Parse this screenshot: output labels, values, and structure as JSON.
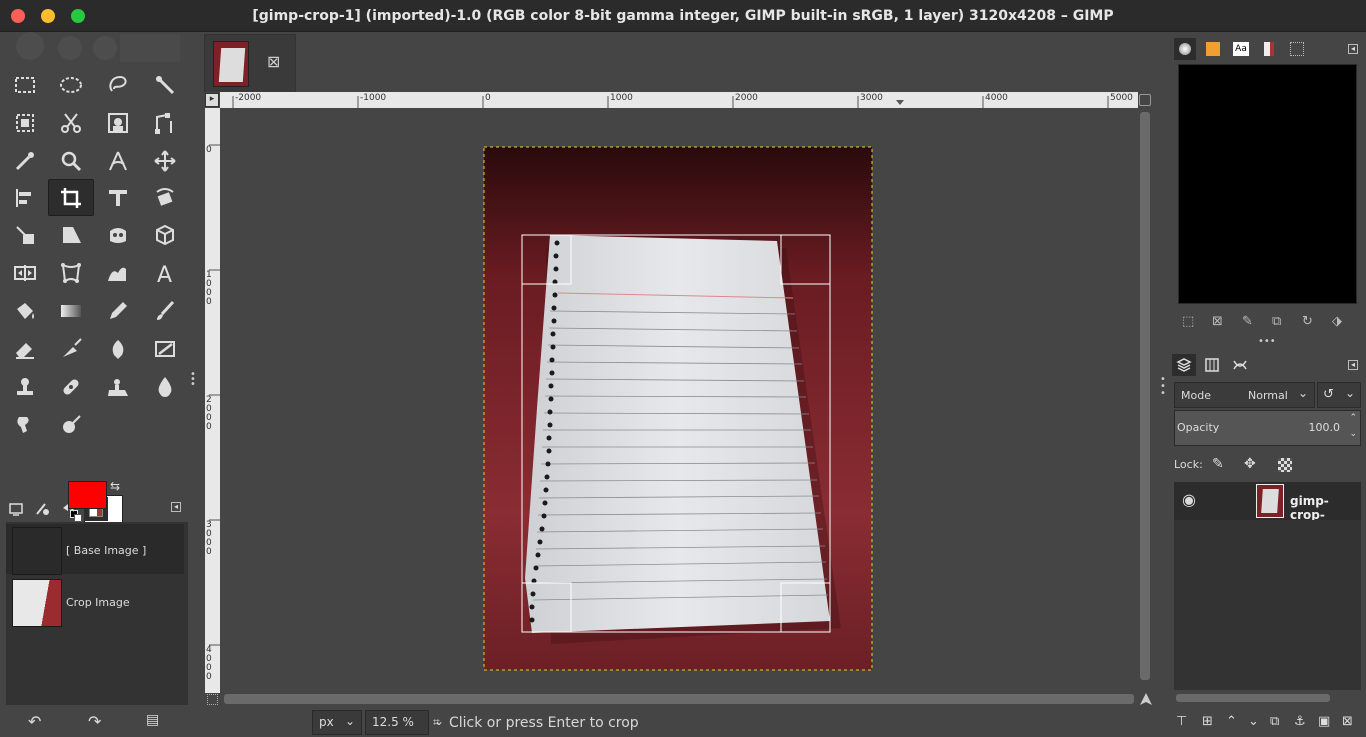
{
  "window": {
    "title": "[gimp-crop-1] (imported)-1.0 (RGB color 8-bit gamma integer, GIMP built-in sRGB, 1 layer) 3120x4208 – GIMP"
  },
  "toolbox": {
    "tools": [
      "rect-select",
      "ellipse-select",
      "free-select",
      "fuzzy-select",
      "by-color-select",
      "scissors-select",
      "foreground-select",
      "paths",
      "color-picker",
      "zoom",
      "measure",
      "move",
      "align",
      "crop",
      "unified-transform",
      "rotate",
      "shear",
      "perspective",
      "3d-transform",
      "flip",
      "warp",
      "cage",
      "text",
      "handle-transform",
      "bucket-fill",
      "blend",
      "pencil",
      "paintbrush",
      "eraser",
      "airbrush",
      "ink",
      "mypaint-brush",
      "clone",
      "heal",
      "perspective-clone",
      "blur",
      "smudge",
      "dodge-burn"
    ],
    "active_tool": "crop",
    "fg_color": "#ff0000",
    "bg_color": "#ffffff"
  },
  "undo_history": {
    "items": [
      {
        "label": "[ Base Image ]"
      },
      {
        "label": "Crop Image"
      }
    ]
  },
  "image_tab": {
    "close_glyph": "⊠"
  },
  "rulers": {
    "horizontal": [
      "-2000",
      "-1000",
      "0",
      "1000",
      "2000",
      "3000",
      "4000",
      "5000"
    ],
    "vertical": [
      "0",
      "1000",
      "2000",
      "3000",
      "4000"
    ]
  },
  "status": {
    "unit": "px",
    "zoom": "12.5 %",
    "message": "Click or press Enter to crop"
  },
  "layers": {
    "mode_label": "Mode",
    "mode_value": "Normal",
    "opacity_label": "Opacity",
    "opacity_value": "100.0",
    "lock_label": "Lock:",
    "layer_name": "gimp-crop-"
  },
  "brush_tabs": [
    "brushes",
    "patterns",
    "fonts",
    "document-history",
    "images"
  ]
}
